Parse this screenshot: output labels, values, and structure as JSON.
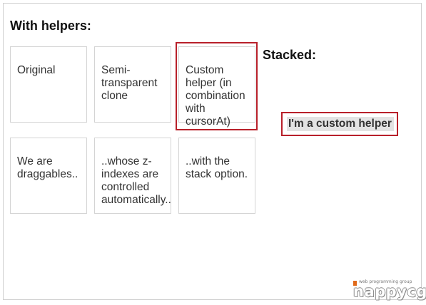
{
  "with_helpers": {
    "heading": "With helpers:",
    "boxes": [
      {
        "lines": [
          "Original"
        ]
      },
      {
        "lines": [
          "Semi-",
          "transparent",
          "clone"
        ]
      },
      {
        "lines": [
          "Custom",
          "helper (in",
          "combination",
          "with",
          "cursorAt)"
        ]
      },
      {
        "lines": [
          "We are",
          "draggables.."
        ]
      },
      {
        "lines": [
          "..whose z-",
          "indexes are",
          "controlled",
          "automatically.."
        ]
      },
      {
        "lines": [
          "..with the",
          "stack option."
        ]
      }
    ]
  },
  "stacked": {
    "heading": "Stacked:"
  },
  "custom_helper": {
    "label": "I'm a custom helper"
  },
  "logo": {
    "tagline": "web programming group",
    "word": "nappycgi"
  },
  "colors": {
    "highlight_outline": "#b8202a",
    "box_border": "#d4d4d4",
    "helper_background": "#e3e3e3",
    "logo_accent": "#e06a1b"
  }
}
